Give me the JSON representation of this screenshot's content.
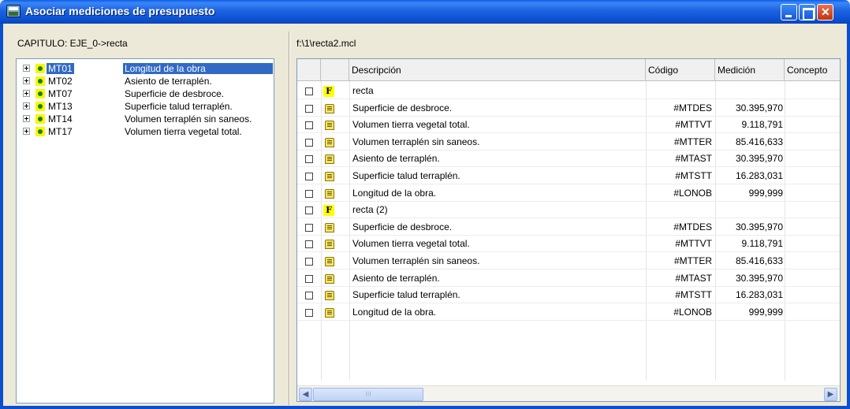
{
  "window": {
    "title": "Asociar mediciones de presupuesto"
  },
  "left_panel": {
    "header": "CAPITULO: EJE_0->recta",
    "tree": [
      {
        "code": "MT01",
        "description": "Longitud de la obra",
        "selected": true
      },
      {
        "code": "MT02",
        "description": "Asiento de terraplén.",
        "selected": false
      },
      {
        "code": "MT07",
        "description": "Superficie de desbroce.",
        "selected": false
      },
      {
        "code": "MT13",
        "description": "Superficie talud terraplén.",
        "selected": false
      },
      {
        "code": "MT14",
        "description": "Volumen terraplén sin saneos.",
        "selected": false
      },
      {
        "code": "MT17",
        "description": "Volumen tierra vegetal total.",
        "selected": false
      }
    ]
  },
  "right_panel": {
    "file_path": "f:\\1\\recta2.mcl",
    "columns": [
      "Descripción",
      "Código",
      "Medición",
      "Concepto"
    ],
    "rows": [
      {
        "type": "F",
        "description": "recta",
        "code": "",
        "medicion": ""
      },
      {
        "type": "M",
        "description": "Superficie de desbroce.",
        "code": "#MTDES",
        "medicion": "30.395,970"
      },
      {
        "type": "M",
        "description": "Volumen tierra vegetal total.",
        "code": "#MTTVT",
        "medicion": "9.118,791"
      },
      {
        "type": "M",
        "description": "Volumen terraplén sin saneos.",
        "code": "#MTTER",
        "medicion": "85.416,633"
      },
      {
        "type": "M",
        "description": "Asiento de terraplén.",
        "code": "#MTAST",
        "medicion": "30.395,970"
      },
      {
        "type": "M",
        "description": "Superficie talud terraplén.",
        "code": "#MTSTT",
        "medicion": "16.283,031"
      },
      {
        "type": "M",
        "description": "Longitud de la obra.",
        "code": "#LONOB",
        "medicion": "999,999"
      },
      {
        "type": "F",
        "description": "recta (2)",
        "code": "",
        "medicion": ""
      },
      {
        "type": "M",
        "description": "Superficie de desbroce.",
        "code": "#MTDES",
        "medicion": "30.395,970"
      },
      {
        "type": "M",
        "description": "Volumen tierra vegetal total.",
        "code": "#MTTVT",
        "medicion": "9.118,791"
      },
      {
        "type": "M",
        "description": "Volumen terraplén sin saneos.",
        "code": "#MTTER",
        "medicion": "85.416,633"
      },
      {
        "type": "M",
        "description": "Asiento de terraplén.",
        "code": "#MTAST",
        "medicion": "30.395,970"
      },
      {
        "type": "M",
        "description": "Superficie talud terraplén.",
        "code": "#MTSTT",
        "medicion": "16.283,031"
      },
      {
        "type": "M",
        "description": "Longitud de la obra.",
        "code": "#LONOB",
        "medicion": "999,999"
      }
    ],
    "f_icon_label": "F",
    "scroll_thumb_grip": "III"
  },
  "colors": {
    "title_bar": "#0b4fd1",
    "selection": "#316ac5",
    "f_icon_bg": "#ffff00",
    "bullet_green": "#138013"
  },
  "icons": {
    "app": "app-icon",
    "minimize": "minimize-icon",
    "maximize": "maximize-icon",
    "close": "close-icon",
    "tree_expander": "plus-box-icon",
    "tree_bullet": "green-dot-icon",
    "folder_row": "f-folder-icon",
    "measurement_row": "clipboard-icon",
    "scroll_left": "arrow-left-icon",
    "scroll_right": "arrow-right-icon"
  }
}
